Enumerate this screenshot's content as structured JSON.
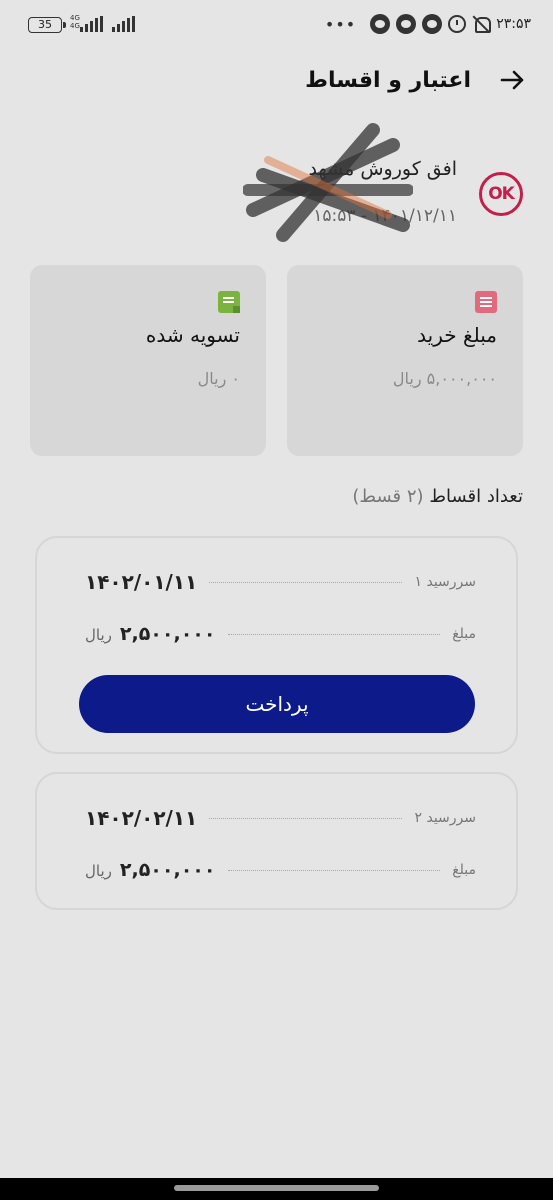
{
  "status_bar": {
    "battery": "35",
    "network": "4G",
    "time": "۲۳:۵۳",
    "icons": [
      "signal-icon",
      "notification-icon",
      "alarm-icon",
      "bell-off-icon"
    ]
  },
  "header": {
    "title": "اعتبار و اقساط",
    "back_icon": "arrow-right-icon"
  },
  "merchant": {
    "logo_text": "OK",
    "logo_color": "#c41e4a",
    "name": "افق کوروش مشهد",
    "datetime": "۱۴۰۱/۱۲/۱۱ - ۱۵:۵۳"
  },
  "summary": {
    "purchase": {
      "title": "مبلغ خرید",
      "value": "۵,۰۰۰,۰۰۰ ریال",
      "icon": "receipt-icon",
      "icon_color": "#e26a7c"
    },
    "settled": {
      "title": "تسویه شده",
      "value": "۰ ریال",
      "icon": "note-icon",
      "icon_color": "#7ab33e"
    }
  },
  "installments": {
    "heading": "تعداد اقساط",
    "count": "(۲ قسط)",
    "items": [
      {
        "due_label": "سررسید ۱",
        "due_date": "۱۴۰۲/۰۱/۱۱",
        "amount_label": "مبلغ",
        "amount": "۲,۵۰۰,۰۰۰",
        "currency": "ریال",
        "pay_label": "پرداخت"
      },
      {
        "due_label": "سررسید ۲",
        "due_date": "۱۴۰۲/۰۲/۱۱",
        "amount_label": "مبلغ",
        "amount": "۲,۵۰۰,۰۰۰",
        "currency": "ریال"
      }
    ]
  },
  "colors": {
    "primary": "#0d1a8a",
    "background": "#e5e5e5",
    "card": "#d7d7d7"
  }
}
